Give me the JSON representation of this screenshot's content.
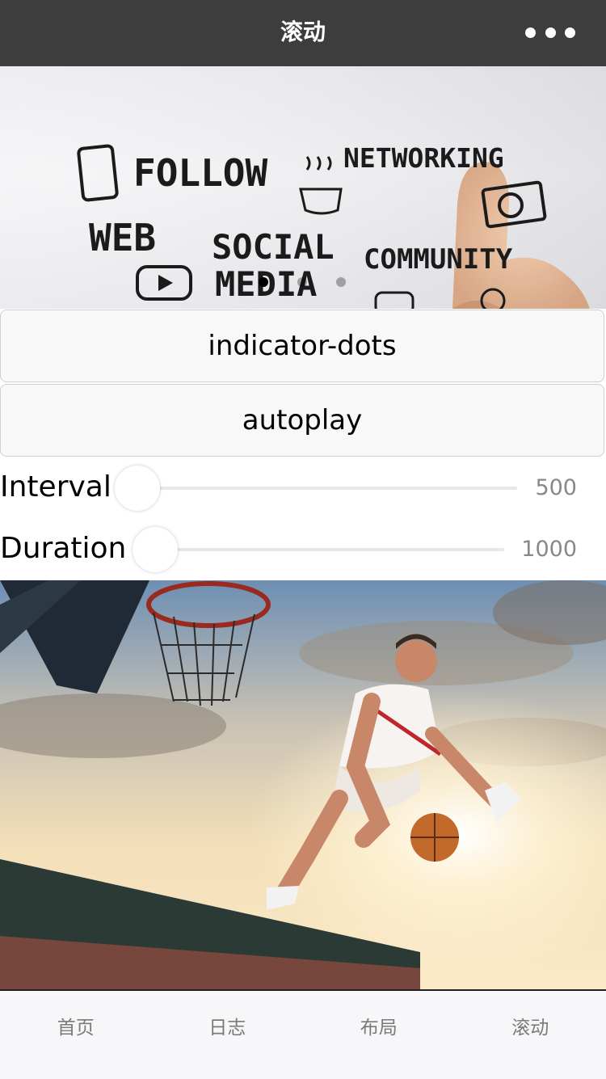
{
  "nav": {
    "title": "滚动",
    "more_icon": "more-dots-icon"
  },
  "banner": {
    "words": [
      "FOLLOW",
      "NETWORKING",
      "WEB",
      "SOCIAL",
      "MEDIA",
      "COMMUNITY"
    ],
    "indicator": {
      "count": 3,
      "active_index": 0
    }
  },
  "controls": {
    "indicator_dots_label": "indicator-dots",
    "autoplay_label": "autoplay"
  },
  "sliders": {
    "interval": {
      "label": "Interval",
      "value": "500"
    },
    "duration": {
      "label": "Duration",
      "value": "1000"
    }
  },
  "tabs": [
    {
      "label": "首页"
    },
    {
      "label": "日志"
    },
    {
      "label": "布局"
    },
    {
      "label": "滚动"
    }
  ],
  "colors": {
    "nav_bg": "#3d3d3d",
    "tab_text": "#7a7a7a",
    "slider_value": "#888888"
  }
}
